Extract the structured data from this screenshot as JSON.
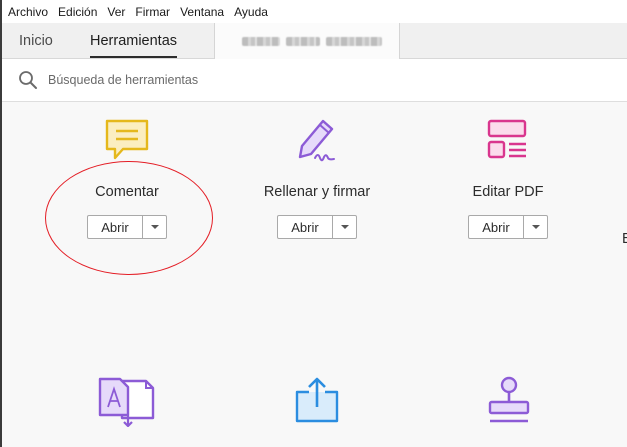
{
  "menu": [
    "Archivo",
    "Edición",
    "Ver",
    "Firmar",
    "Ventana",
    "Ayuda"
  ],
  "tabs": {
    "home": "Inicio",
    "tools": "Herramientas",
    "document_name_redacted": true
  },
  "search": {
    "placeholder": "Búsqueda de herramientas",
    "icon": "search-icon"
  },
  "tools_row1": [
    {
      "label": "Comentar",
      "button": "Abrir",
      "icon": "comment-icon",
      "color": "#e5b81c",
      "highlighted": true
    },
    {
      "label": "Rellenar y firmar",
      "button": "Abrir",
      "icon": "fill-sign-icon",
      "color": "#8c5bd6"
    },
    {
      "label": "Editar PDF",
      "button": "Abrir",
      "icon": "edit-pdf-icon",
      "color": "#d9368e"
    }
  ],
  "partial_tool_label": "E",
  "tools_row2": [
    {
      "icon": "export-pdf-icon",
      "color": "#8c5bd6"
    },
    {
      "icon": "share-icon",
      "color": "#2b8de0"
    },
    {
      "icon": "stamp-icon",
      "color": "#8c5bd6"
    }
  ],
  "annotation": {
    "color": "#e41e26",
    "shape": "ellipse"
  }
}
